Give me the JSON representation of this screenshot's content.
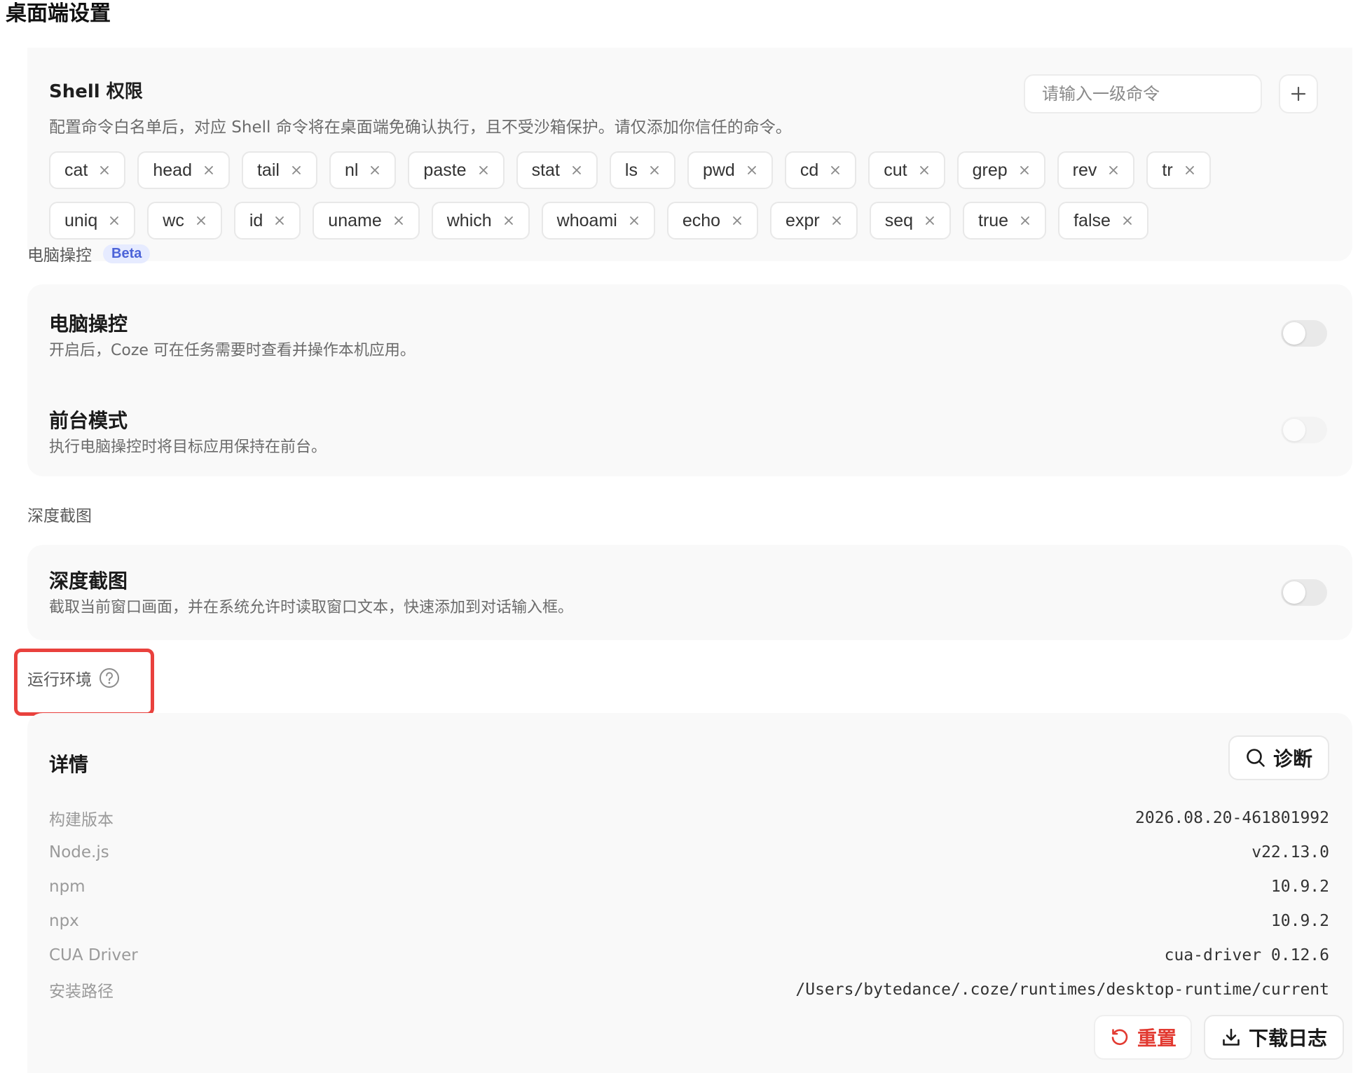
{
  "window": {
    "title": "桌面端设置"
  },
  "shell": {
    "title": "Shell 权限",
    "description": "配置命令白名单后，对应 Shell 命令将在桌面端免确认执行，且不受沙箱保护。请仅添加你信任的命令。",
    "input_placeholder": "请输入一级命令",
    "add_icon": "plus-icon",
    "remove_icon": "close-icon",
    "commands_row1": [
      "cat",
      "head",
      "tail",
      "nl",
      "paste",
      "stat",
      "ls",
      "pwd",
      "cd",
      "cut",
      "grep",
      "rev",
      "tr"
    ],
    "commands_row2": [
      "uniq",
      "wc",
      "id",
      "uname",
      "which",
      "whoami",
      "echo",
      "expr",
      "seq",
      "true",
      "false"
    ]
  },
  "computer_control": {
    "section_label": "电脑操控",
    "badge": "Beta",
    "items": [
      {
        "title": "电脑操控",
        "description": "开启后，Coze 可在任务需要时查看并操作本机应用。",
        "enabled": false
      },
      {
        "title": "前台模式",
        "description": "执行电脑操控时将目标应用保持在前台。",
        "enabled": false,
        "disabled": true
      }
    ]
  },
  "deep_screenshot": {
    "section_label": "深度截图",
    "title": "深度截图",
    "description": "截取当前窗口画面，并在系统允许时读取窗口文本，快速添加到对话输入框。",
    "enabled": false
  },
  "runtime": {
    "section_label": "运行环境",
    "help_icon": "question-circle-icon",
    "highlight_color": "#e9413d",
    "details_title": "详情",
    "diagnose_label": "诊断",
    "rows": [
      {
        "key": "构建版本",
        "value": "2026.08.20-461801992"
      },
      {
        "key": "Node.js",
        "value": "v22.13.0"
      },
      {
        "key": "npm",
        "value": "10.9.2"
      },
      {
        "key": "npx",
        "value": "10.9.2"
      },
      {
        "key": "CUA Driver",
        "value": "cua-driver 0.12.6"
      },
      {
        "key": "安装路径",
        "value": "/Users/bytedance/.coze/runtimes/desktop-runtime/current"
      }
    ],
    "reset_label": "重置",
    "reset_color": "#e23a31",
    "download_label": "下载日志"
  }
}
